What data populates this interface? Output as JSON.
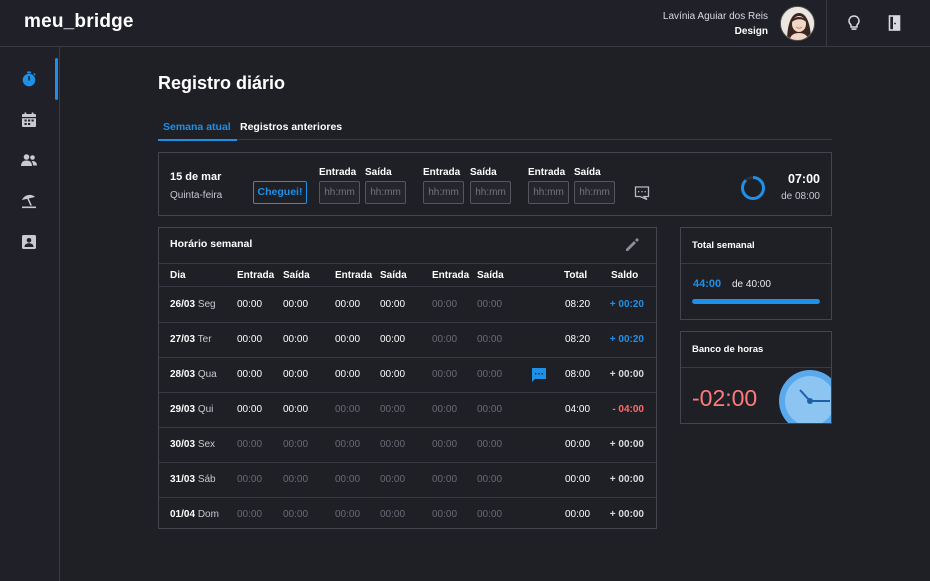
{
  "app": {
    "logo": "meu_bridge"
  },
  "user": {
    "name": "Lavínia Aguiar dos Reis",
    "role": "Design"
  },
  "header_icons": [
    "lightbulb-icon",
    "door-exit-icon"
  ],
  "sidebar": {
    "items": [
      {
        "name": "stopwatch-icon",
        "active": true
      },
      {
        "name": "calendar-icon",
        "active": false
      },
      {
        "name": "people-icon",
        "active": false
      },
      {
        "name": "beach-umbrella-icon",
        "active": false
      },
      {
        "name": "id-badge-icon",
        "active": false
      }
    ]
  },
  "page": {
    "title": "Registro diário"
  },
  "tabs": [
    {
      "label": "Semana atual",
      "active": true
    },
    {
      "label": "Registros anteriores",
      "active": false
    }
  ],
  "today": {
    "date": "15 de mar",
    "weekday": "Quinta-feira",
    "button": "Cheguei!",
    "entrada_label": "Entrada",
    "saida_label": "Saída",
    "placeholder": "hh:mm",
    "total": "07:00",
    "of": "de 08:00",
    "progress": 0.875
  },
  "week": {
    "title": "Horário semanal",
    "headers": {
      "dia": "Dia",
      "entrada": "Entrada",
      "saida": "Saída",
      "total": "Total",
      "saldo": "Saldo"
    },
    "rows": [
      {
        "date": "26/03",
        "day": "Seg",
        "times": [
          "00:00",
          "00:00",
          "00:00",
          "00:00",
          "00:00",
          "00:00"
        ],
        "filled": 4,
        "total": "08:20",
        "saldo": "+ 00:20",
        "saldo_type": "pos",
        "comment": false
      },
      {
        "date": "27/03",
        "day": "Ter",
        "times": [
          "00:00",
          "00:00",
          "00:00",
          "00:00",
          "00:00",
          "00:00"
        ],
        "filled": 4,
        "total": "08:20",
        "saldo": "+ 00:20",
        "saldo_type": "pos",
        "comment": false
      },
      {
        "date": "28/03",
        "day": "Qua",
        "times": [
          "00:00",
          "00:00",
          "00:00",
          "00:00",
          "00:00",
          "00:00"
        ],
        "filled": 4,
        "total": "08:00",
        "saldo": "+ 00:00",
        "saldo_type": "neu",
        "comment": true
      },
      {
        "date": "29/03",
        "day": "Qui",
        "times": [
          "00:00",
          "00:00",
          "00:00",
          "00:00",
          "00:00",
          "00:00"
        ],
        "filled": 2,
        "total": "04:00",
        "saldo": "- 04:00",
        "saldo_type": "neg",
        "comment": false
      },
      {
        "date": "30/03",
        "day": "Sex",
        "times": [
          "00:00",
          "00:00",
          "00:00",
          "00:00",
          "00:00",
          "00:00"
        ],
        "filled": 0,
        "total": "00:00",
        "saldo": "+ 00:00",
        "saldo_type": "neu",
        "comment": false
      },
      {
        "date": "31/03",
        "day": "Sáb",
        "times": [
          "00:00",
          "00:00",
          "00:00",
          "00:00",
          "00:00",
          "00:00"
        ],
        "filled": 0,
        "total": "00:00",
        "saldo": "+ 00:00",
        "saldo_type": "neu",
        "comment": false
      },
      {
        "date": "01/04",
        "day": "Dom",
        "times": [
          "00:00",
          "00:00",
          "00:00",
          "00:00",
          "00:00",
          "00:00"
        ],
        "filled": 0,
        "total": "00:00",
        "saldo": "+ 00:00",
        "saldo_type": "neu",
        "comment": false
      }
    ]
  },
  "total_semanal": {
    "title": "Total semanal",
    "hours": "44:00",
    "of": "de 40:00",
    "progress": 1.0
  },
  "banco_horas": {
    "title": "Banco de horas",
    "value": "-02:00"
  },
  "colors": {
    "accent": "#1e90e8",
    "negative": "#ff6b6b",
    "background": "#1f1f26"
  }
}
